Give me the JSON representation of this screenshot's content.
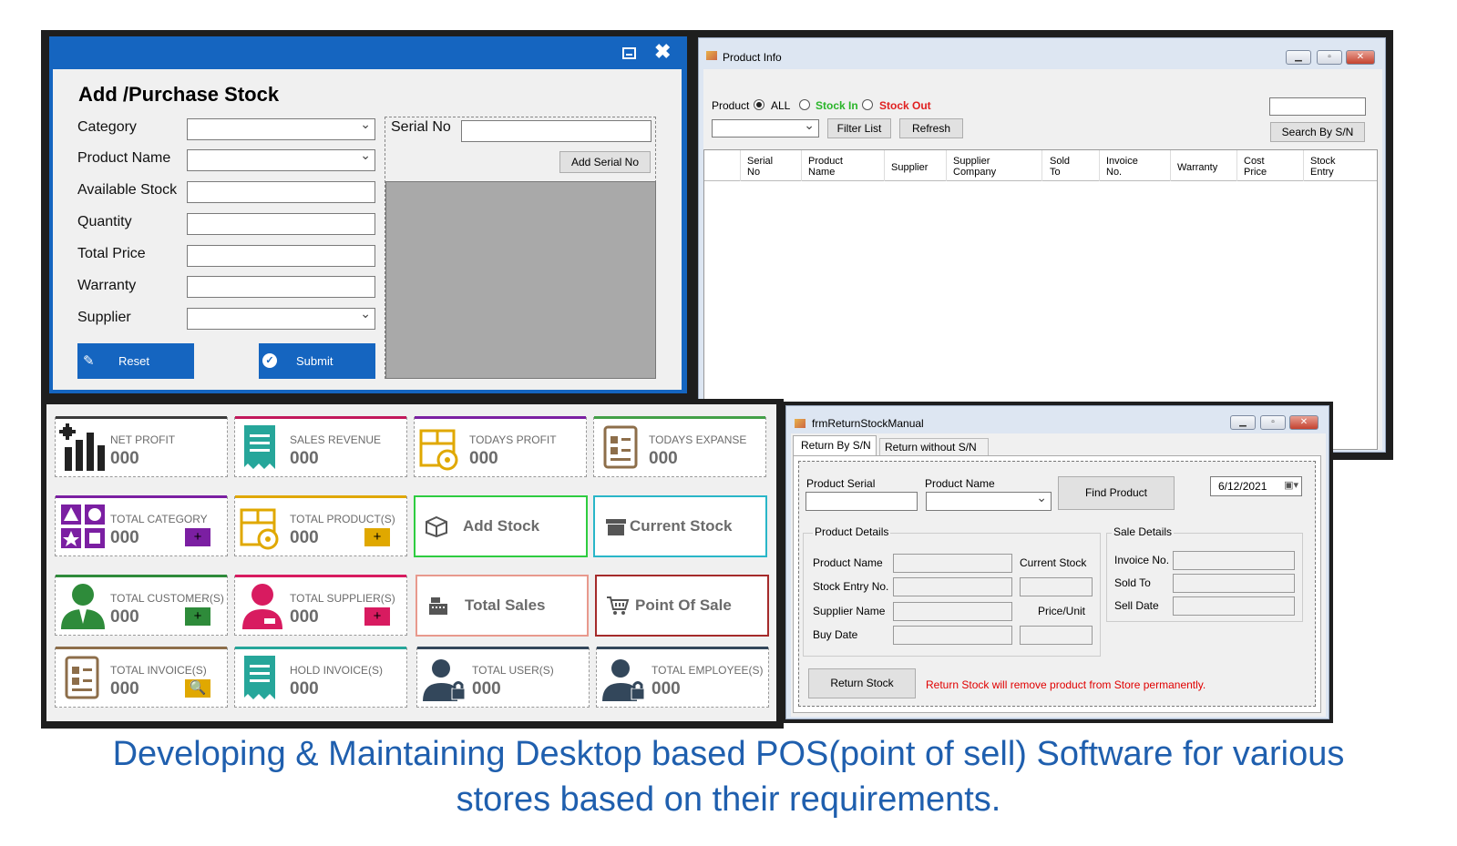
{
  "add_stock_form": {
    "title": "Add /Purchase Stock",
    "labels": {
      "category": "Category",
      "product_name": "Product Name",
      "available_stock": "Available Stock",
      "quantity": "Quantity",
      "total_price": "Total Price",
      "warranty": "Warranty",
      "supplier": "Supplier",
      "serial_no": "Serial No"
    },
    "add_serial_button": "Add Serial No",
    "reset_button": "Reset",
    "submit_button": "Submit"
  },
  "product_info": {
    "window_title": "Product Info",
    "product_label": "Product",
    "radio_all": "ALL",
    "radio_stock_in": "Stock In",
    "radio_stock_out": "Stock Out",
    "filter_button": "Filter List",
    "refresh_button": "Refresh",
    "search_button": "Search By S/N",
    "columns": [
      "Serial\nNo",
      "Product\nName",
      "Supplier",
      "Supplier\nCompany",
      "Sold\nTo",
      "Invoice\nNo.",
      "Warranty",
      "Cost\nPrice",
      "Stock\nEntry"
    ]
  },
  "dashboard": {
    "cards": [
      {
        "title": "NET PROFIT",
        "value": "000"
      },
      {
        "title": "SALES REVENUE",
        "value": "000"
      },
      {
        "title": "TODAYS PROFIT",
        "value": "000"
      },
      {
        "title": "TODAYS EXPANSE",
        "value": "000"
      },
      {
        "title": "TOTAL CATEGORY",
        "value": "000",
        "action": "+"
      },
      {
        "title": "TOTAL PRODUCT(S)",
        "value": "000",
        "action": "+"
      },
      {
        "title": "TOTAL CUSTOMER(S)",
        "value": "000",
        "action": "+"
      },
      {
        "title": "TOTAL SUPPLIER(S)",
        "value": "000",
        "action": "+"
      },
      {
        "title": "TOTAL INVOICE(S)",
        "value": "000"
      },
      {
        "title": "HOLD INVOICE(S)",
        "value": "000"
      },
      {
        "title": "TOTAL USER(S)",
        "value": "000"
      },
      {
        "title": "TOTAL EMPLOYEE(S)",
        "value": "000"
      }
    ],
    "actions": {
      "add_stock": "Add Stock",
      "current_stock": "Current Stock",
      "total_sales": "Total Sales",
      "point_of_sale": "Point Of Sale"
    },
    "colors": {
      "net_profit": "#3a3a3a",
      "sales_revenue": "#c2185b",
      "todays_profit": "#7b1fa2",
      "todays_expanse": "#43a047",
      "category": "#7b1fa2",
      "product": "#e0a800",
      "customer": "#2e8b3a",
      "supplier": "#d81b60",
      "invoice": "#8d6e4a",
      "hold_invoice": "#26a69a",
      "user": "#33475b",
      "employee": "#33475b",
      "add_stock": "#2ecc40",
      "current_stock": "#29b6c8",
      "total_sales": "#e8998d",
      "point_of_sale": "#a52a2a"
    }
  },
  "return_stock": {
    "window_title": "frmReturnStockManual",
    "tabs": [
      "Return By S/N",
      "Return without S/N"
    ],
    "product_serial_label": "Product Serial",
    "product_name_label": "Product Name",
    "find_button": "Find Product",
    "date": "6/12/2021",
    "product_details_title": "Product Details",
    "pd_product_name": "Product Name",
    "pd_current_stock": "Current Stock",
    "pd_stock_entry": "Stock Entry No.",
    "pd_supplier_name": "Supplier Name",
    "pd_price_unit": "Price/Unit",
    "pd_buy_date": "Buy Date",
    "sale_details_title": "Sale Details",
    "sd_invoice": "Invoice No.",
    "sd_sold_to": "Sold To",
    "sd_sell_date": "Sell Date",
    "return_button": "Return Stock",
    "warning": "Return Stock will remove product from Store permanently."
  },
  "caption": {
    "line1": "Developing & Maintaining Desktop based POS(point of sell) Software for various",
    "line2": "stores based on their requirements."
  }
}
